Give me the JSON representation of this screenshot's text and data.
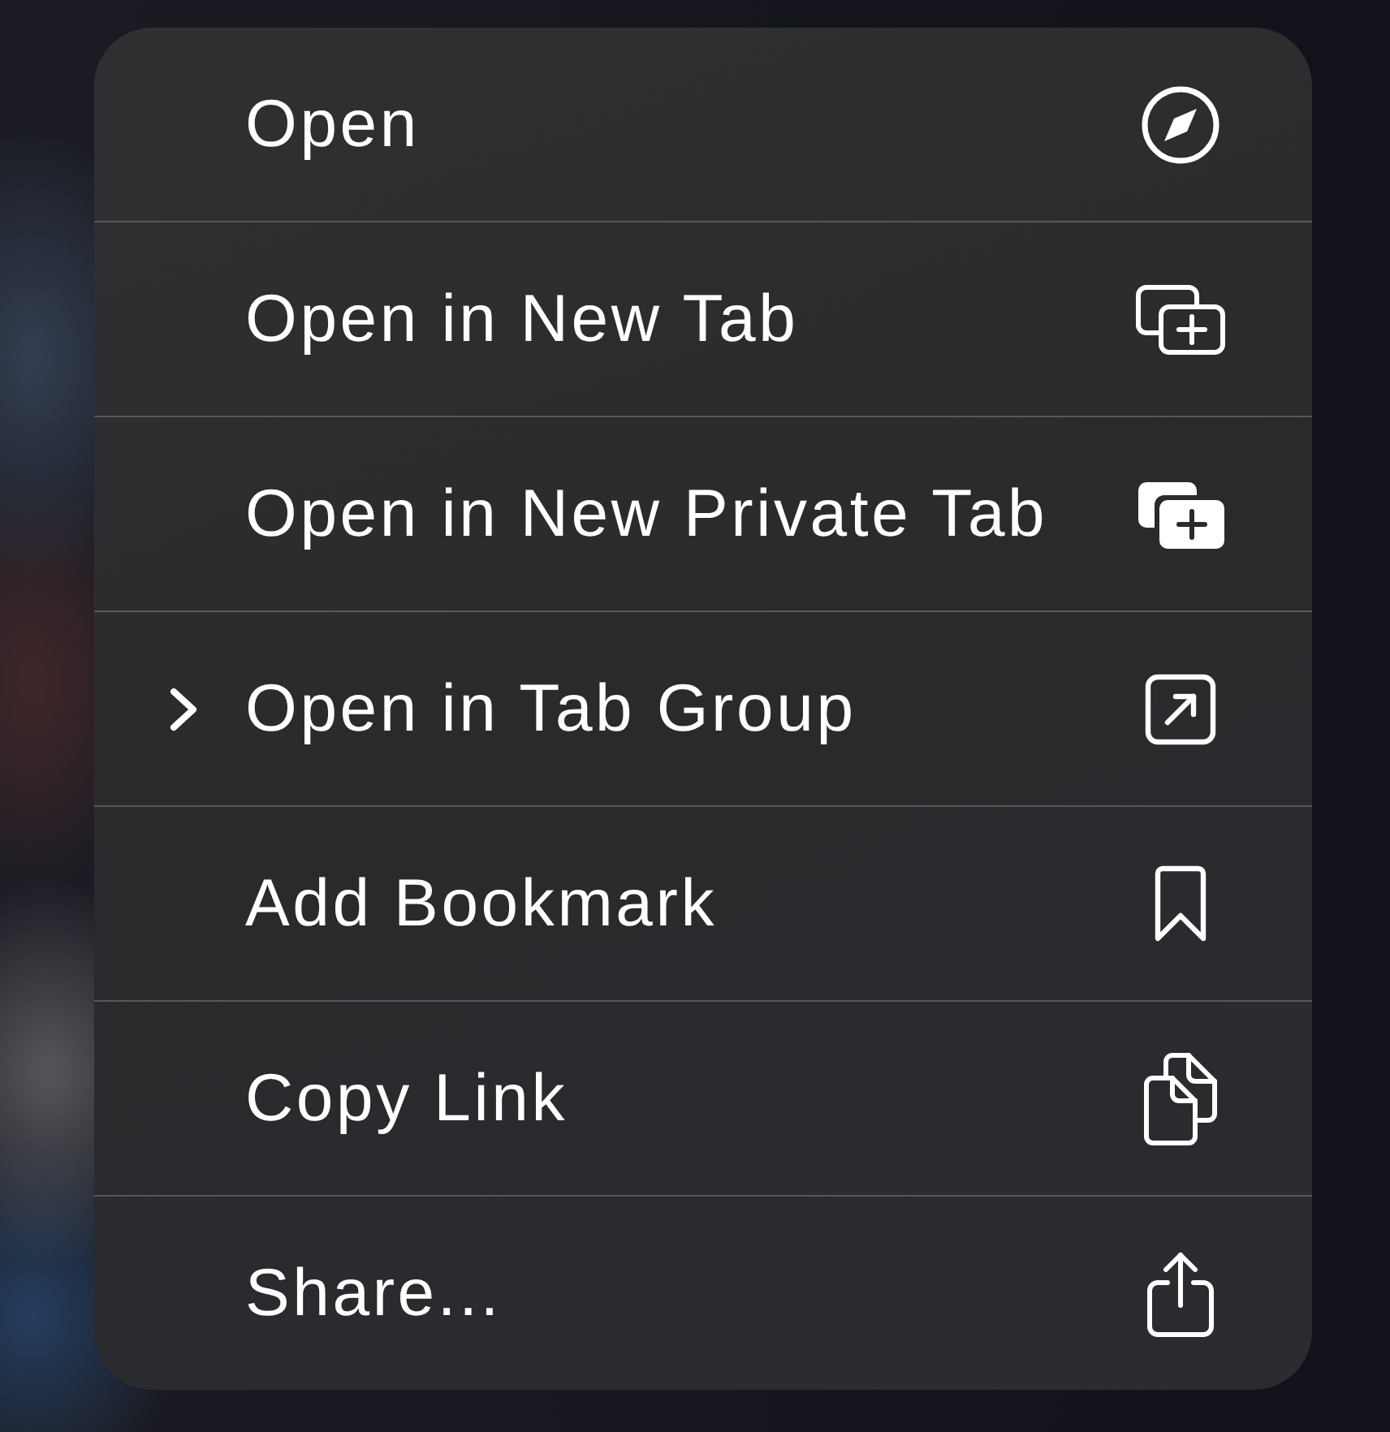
{
  "menu": {
    "items": [
      {
        "label": "Open",
        "submenu": false
      },
      {
        "label": "Open in New Tab",
        "submenu": false
      },
      {
        "label": "Open in New Private Tab",
        "submenu": false
      },
      {
        "label": "Open in Tab Group",
        "submenu": true
      },
      {
        "label": "Add Bookmark",
        "submenu": false
      },
      {
        "label": "Copy Link",
        "submenu": false
      },
      {
        "label": "Share...",
        "submenu": false
      }
    ]
  }
}
